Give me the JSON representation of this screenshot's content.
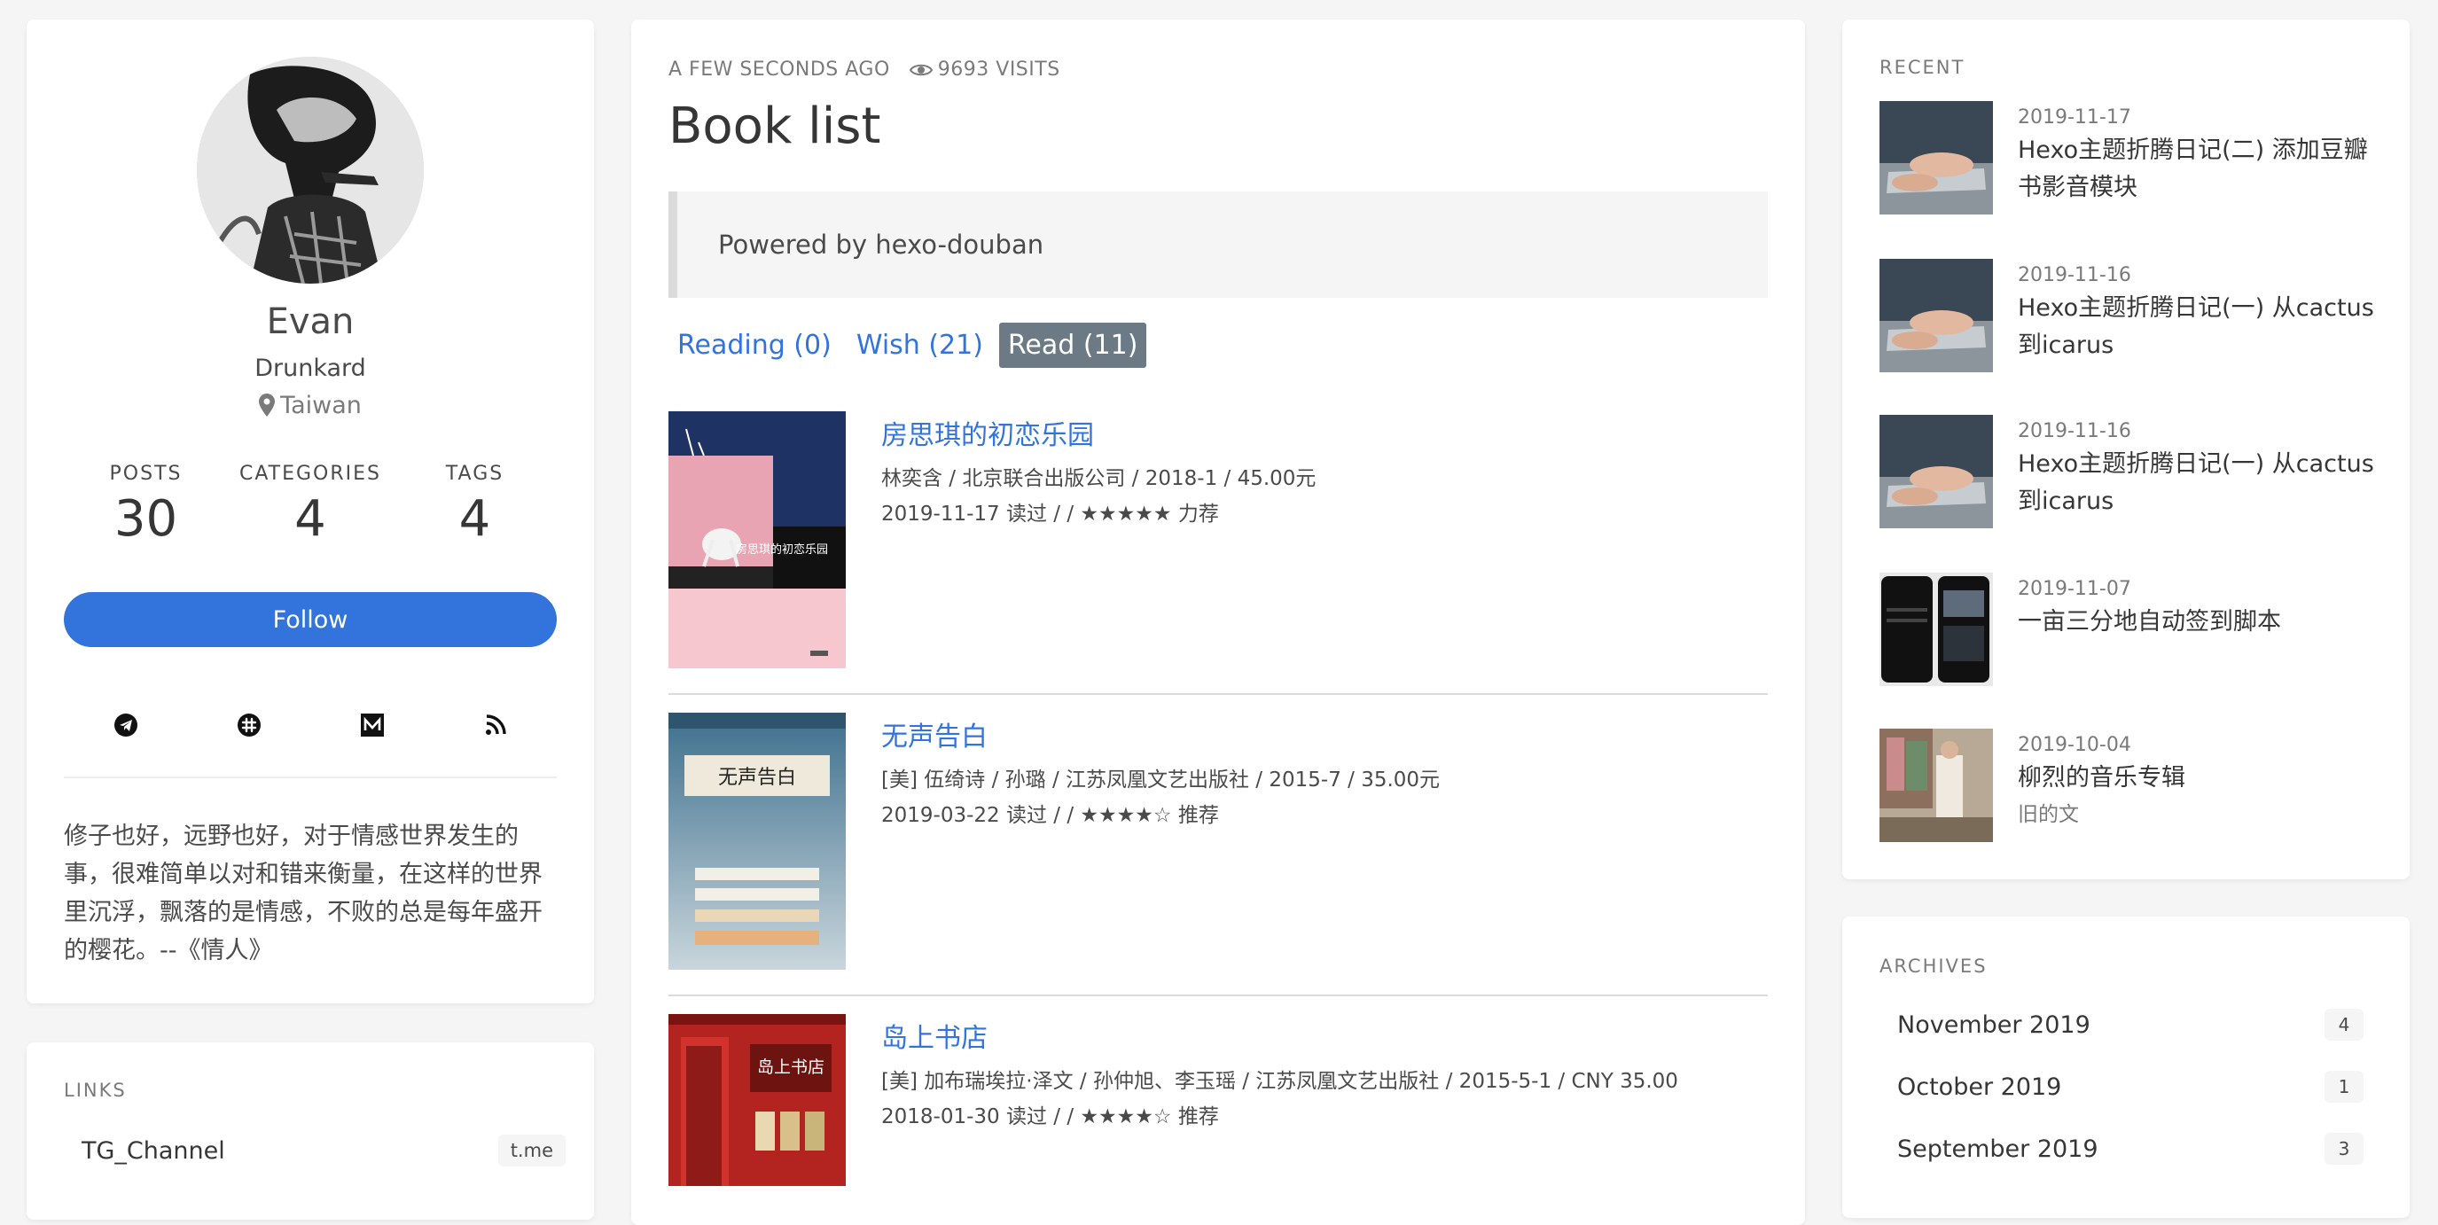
{
  "profile": {
    "name": "Evan",
    "title": "Drunkard",
    "location": "Taiwan",
    "stats": [
      {
        "label": "POSTS",
        "value": "30"
      },
      {
        "label": "CATEGORIES",
        "value": "4"
      },
      {
        "label": "TAGS",
        "value": "4"
      }
    ],
    "follow_label": "Follow",
    "socials": [
      "telegram-icon",
      "slack-icon",
      "medium-icon",
      "rss-icon"
    ],
    "bio": "修子也好，远野也好，对于情感世界发生的事，很难简单以对和错来衡量，在这样的世界里沉浮，飘落的是情感，不败的总是每年盛开的樱花。--《情人》"
  },
  "links": {
    "title": "LINKS",
    "items": [
      {
        "name": "TG_Channel",
        "host": "t.me"
      }
    ]
  },
  "article": {
    "updated": "A FEW SECONDS AGO",
    "visits": "9693 VISITS",
    "title": "Book list",
    "quote": "Powered by hexo-douban",
    "tabs": [
      "Reading (0)",
      "Wish (21)",
      "Read (11)"
    ],
    "active_tab": 2,
    "books": [
      {
        "title": "房思琪的初恋乐园",
        "meta": "林奕含 / 北京联合出版公司 / 2018-1 / 45.00元",
        "rating": "2019-11-17 读过 / / ★★★★★ 力荐",
        "cover_text": "房思琪的初恋乐园"
      },
      {
        "title": "无声告白",
        "meta": "[美] 伍绮诗 / 孙璐 / 江苏凤凰文艺出版社 / 2015-7 / 35.00元",
        "rating": "2019-03-22 读过 / / ★★★★☆ 推荐",
        "cover_text": "无声告白"
      },
      {
        "title": "岛上书店",
        "meta": "[美] 加布瑞埃拉·泽文 / 孙仲旭、李玉瑶 / 江苏凤凰文艺出版社 / 2015-5-1 / CNY 35.00",
        "rating": "2018-01-30 读过 / / ★★★★☆ 推荐",
        "cover_text": "岛上书店"
      }
    ]
  },
  "recent": {
    "title": "RECENT",
    "posts": [
      {
        "date": "2019-11-17",
        "title": "Hexo主题折腾日记(二) 添加豆瓣书影音模块",
        "category": ""
      },
      {
        "date": "2019-11-16",
        "title": "Hexo主题折腾日记(一) 从cactus到icarus",
        "category": ""
      },
      {
        "date": "2019-11-16",
        "title": "Hexo主题折腾日记(一) 从cactus到icarus",
        "category": ""
      },
      {
        "date": "2019-11-07",
        "title": "一亩三分地自动签到脚本",
        "category": ""
      },
      {
        "date": "2019-10-04",
        "title": "柳烈的音乐专辑",
        "category": "旧的文"
      }
    ]
  },
  "archives": {
    "title": "ARCHIVES",
    "items": [
      {
        "name": "November 2019",
        "count": "4"
      },
      {
        "name": "October 2019",
        "count": "1"
      },
      {
        "name": "September 2019",
        "count": "3"
      }
    ]
  },
  "colors": {
    "accent": "#3273dc",
    "active_tab": "#6b7a85",
    "background": "#f5f5f5"
  }
}
